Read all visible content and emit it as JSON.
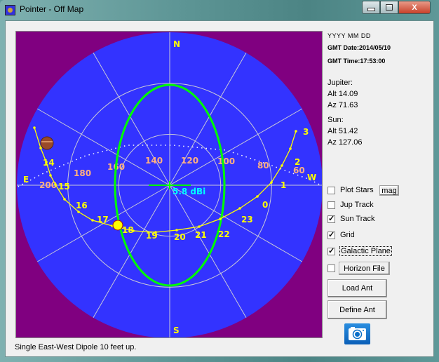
{
  "window": {
    "title": "Pointer - Off Map",
    "minimize_label": "",
    "maximize_label": "",
    "close_label": "X"
  },
  "info": {
    "date_format": "YYYY MM DD",
    "gmt_date": "GMT Date:2014/05/10",
    "gmt_time": "GMT Time:17:53:00",
    "jupiter_label": "Jupiter:",
    "jupiter_alt": "Alt 14.09",
    "jupiter_az": "Az 71.63",
    "sun_label": "Sun:",
    "sun_alt": "Alt 51.42",
    "sun_az": "Az 127.06"
  },
  "controls": {
    "plot_stars": {
      "label": "Plot Stars",
      "checked": false
    },
    "mag_button": "mag",
    "jup_track": {
      "label": "Jup Track",
      "checked": false
    },
    "sun_track": {
      "label": "Sun Track",
      "checked": true
    },
    "grid": {
      "label": "Grid",
      "checked": true
    },
    "galactic_plane": {
      "label": "Galactic Plane",
      "checked": true
    },
    "horizon_file": {
      "label": "",
      "checked": false
    },
    "horizon_file_button": "Horizon File",
    "load_ant": "Load Ant",
    "define_ant": "Define Ant",
    "camera_icon": "camera-icon"
  },
  "status": "Single East-West Dipole 10 feet up.",
  "sky_map": {
    "compass": {
      "N": "N",
      "S": "S",
      "E": "E",
      "W": "W"
    },
    "gain_label": "5.8 dBi",
    "colors": {
      "background": "#800080",
      "sky": "#3333ff",
      "grid": "#c8c8d8",
      "antenna_pattern": "#00ff00",
      "sun_track": "#ffff00",
      "galactic_labels": "#ffb080",
      "gain_text": "#00ffff",
      "sun": "#ffff00"
    },
    "grid_altitudes_deg": [
      0,
      30,
      60
    ],
    "grid_azimuth_step_deg": 30,
    "sun_track_hours": [
      "14",
      "15",
      "16",
      "17",
      "18",
      "19",
      "20",
      "21",
      "22",
      "23",
      "0",
      "1",
      "2",
      "3"
    ],
    "galactic_labels": [
      "200",
      "180",
      "160",
      "140",
      "120",
      "100",
      "80",
      "60"
    ],
    "sun": {
      "alt": 51.42,
      "az": 127.06
    },
    "jupiter": {
      "alt": 14.09,
      "az": 71.63
    }
  }
}
